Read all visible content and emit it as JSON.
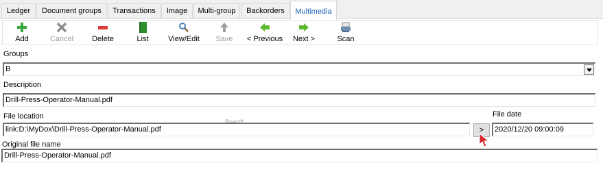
{
  "tabs": [
    {
      "label": "Ledger"
    },
    {
      "label": "Document groups"
    },
    {
      "label": "Transactions"
    },
    {
      "label": "Image"
    },
    {
      "label": "Multi-group"
    },
    {
      "label": "Backorders"
    },
    {
      "label": "Multimedia"
    }
  ],
  "active_tab": "Multimedia",
  "toolbar": {
    "add": "Add",
    "cancel": "Cancel",
    "delete": "Delete",
    "list": "List",
    "view_edit": "View/Edit",
    "save": "Save",
    "previous": "< Previous",
    "next": "Next >",
    "scan": "Scan"
  },
  "form": {
    "groups_label": "Groups",
    "groups_value": "B",
    "description_label": "Description",
    "description_value": "Drill-Press-Operator-Manual.pdf",
    "file_location_label": "File location",
    "file_location_value": "link:D:\\MyDox\\Drill-Press-Operator-Manual.pdf",
    "browse_label": ">",
    "file_date_label": "File date",
    "file_date_value": "2020/12/20 09:00:09",
    "original_name_label": "Original file name",
    "original_name_value": "Drill-Press-Operator-Manual.pdf"
  },
  "colors": {
    "active_tab_text": "#1a5fb4",
    "add_icon": "#3aa63a",
    "delete_icon": "#e03b3b",
    "list_icon": "#2f8f2f",
    "arrow_icon": "#5cb82e",
    "cursor": "#d9252a"
  },
  "icons": [
    "add-icon",
    "cancel-icon",
    "delete-icon",
    "list-icon",
    "view-edit-icon",
    "save-icon",
    "previous-icon",
    "next-icon",
    "scan-icon",
    "cursor-icon"
  ]
}
